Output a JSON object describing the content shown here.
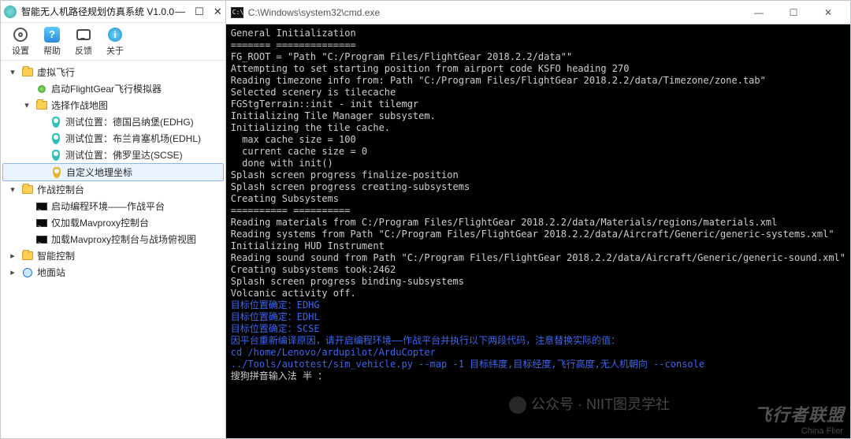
{
  "left": {
    "title": "智能无人机路径规划仿真系统 V1.0.0",
    "ribbon": {
      "settings": "设置",
      "help": "帮助",
      "feedback": "反馈",
      "about": "关于"
    },
    "tree": [
      {
        "depth": 0,
        "expander": "▾",
        "icon": "folder",
        "label": "虚拟飞行"
      },
      {
        "depth": 1,
        "expander": "",
        "icon": "ball-green",
        "label": "启动FlightGear飞行模拟器"
      },
      {
        "depth": 1,
        "expander": "▾",
        "icon": "folder",
        "label": "选择作战地图"
      },
      {
        "depth": 2,
        "expander": "",
        "icon": "pin-teal",
        "label": "测试位置：德国吕纳堡(EDHG)"
      },
      {
        "depth": 2,
        "expander": "",
        "icon": "pin-teal",
        "label": "测试位置：布兰肯塞机场(EDHL)"
      },
      {
        "depth": 2,
        "expander": "",
        "icon": "pin-teal",
        "label": "测试位置：佛罗里达(SCSE)"
      },
      {
        "depth": 2,
        "expander": "",
        "icon": "pin-yellow",
        "label": "自定义地理坐标",
        "selected": true
      },
      {
        "depth": 0,
        "expander": "▾",
        "icon": "folder",
        "label": "作战控制台"
      },
      {
        "depth": 1,
        "expander": "",
        "icon": "term",
        "label": "启动编程环境——作战平台"
      },
      {
        "depth": 1,
        "expander": "",
        "icon": "term",
        "label": "仅加载Mavproxy控制台"
      },
      {
        "depth": 1,
        "expander": "",
        "icon": "term",
        "label": "加载Mavproxy控制台与战场俯视图"
      },
      {
        "depth": 0,
        "expander": "▸",
        "icon": "folder",
        "label": "智能控制"
      },
      {
        "depth": 0,
        "expander": "▸",
        "icon": "globe",
        "label": "地面站"
      }
    ]
  },
  "cmd": {
    "title": "C:\\Windows\\system32\\cmd.exe"
  },
  "console": {
    "lines": [
      "General Initialization",
      "======= ==============",
      "FG_ROOT = \"Path \"C:/Program Files/FlightGear 2018.2.2/data\"\"",
      "",
      "Attempting to set starting position from airport code KSFO heading 270",
      "Reading timezone info from: Path \"C:/Program Files/FlightGear 2018.2.2/data/Timezone/zone.tab\"",
      "Selected scenery is tilecache",
      "FGStgTerrain::init - init tilemgr",
      "Initializing Tile Manager subsystem.",
      "Initializing the tile cache.",
      "  max cache size = 100",
      "  current cache size = 0",
      "  done with init()",
      "Splash screen progress finalize-position",
      "Splash screen progress creating-subsystems",
      "Creating Subsystems",
      "========== ==========",
      "Reading materials from C:/Program Files/FlightGear 2018.2.2/data/Materials/regions/materials.xml",
      "Reading systems from Path \"C:/Program Files/FlightGear 2018.2.2/data/Aircraft/Generic/generic-systems.xml\"",
      "Initializing HUD Instrument",
      "Reading sound sound from Path \"C:/Program Files/FlightGear 2018.2.2/data/Aircraft/Generic/generic-sound.xml\"",
      "Creating subsystems took:2462",
      "Splash screen progress binding-subsystems",
      "Volcanic activity off.",
      ""
    ],
    "blue_lines": [
      "目标位置确定：EDHG",
      "目标位置确定：EDHL",
      "目标位置确定：SCSE",
      "因平台重新编译原因，请开启编程环境——作战平台并执行以下两段代码，注意替换实际的值：",
      "cd /home/Lenovo/ardupilot/ArduCopter",
      "../Tools/autotest/sim_vehicle.py --map -1 目标纬度,目标经度,飞行高度,无人机朝向 --console"
    ],
    "ime": "搜狗拼音输入法 半 ："
  },
  "overlay": {
    "wechat": "公众号 · NIIT图灵学社",
    "brand": "飞行者联盟",
    "brand_en": "China Flier"
  }
}
